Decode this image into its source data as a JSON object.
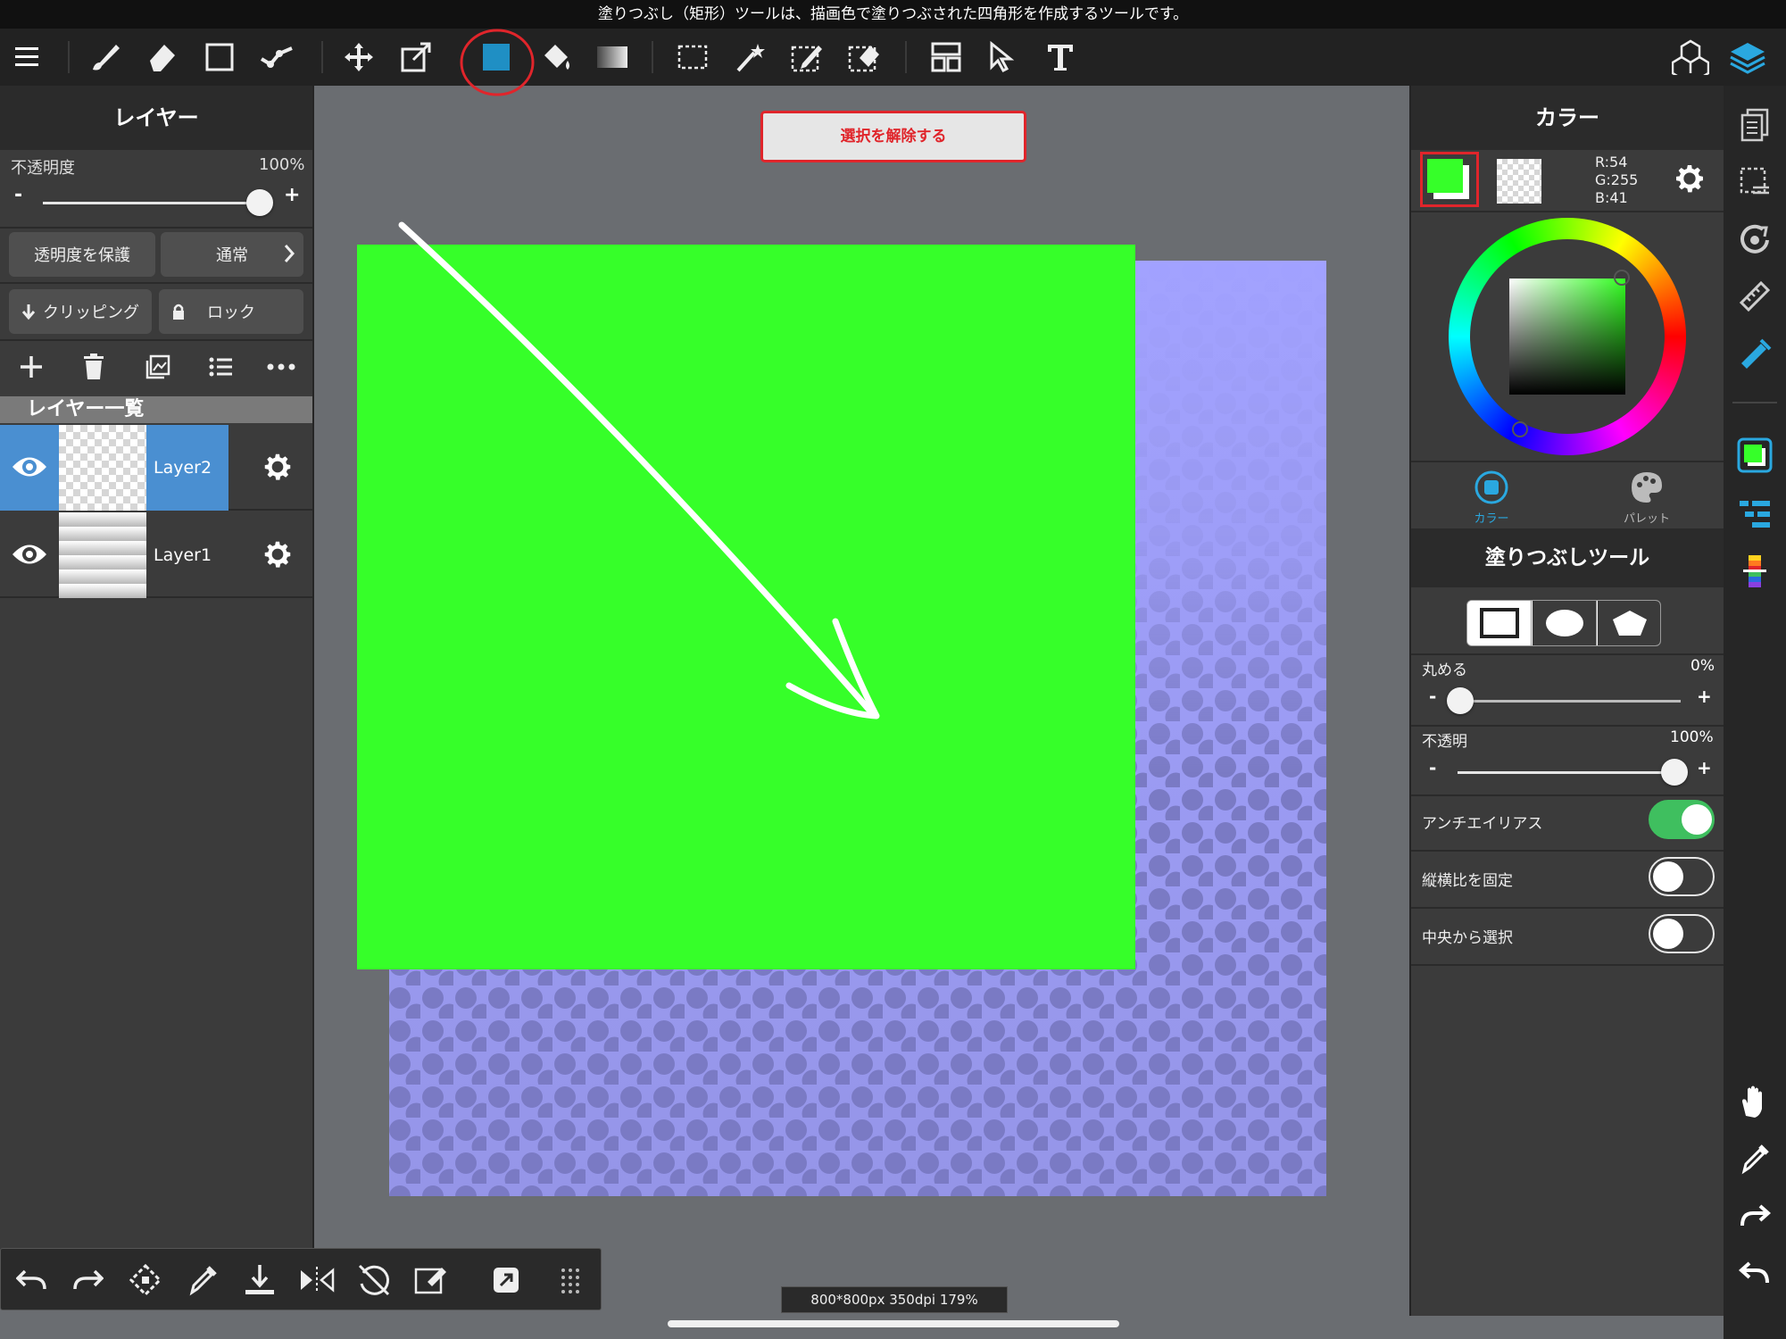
{
  "caption": "塗りつぶし（矩形）ツールは、描画色で塗りつぶされた四角形を作成するツールです。",
  "toolbar": {
    "tools": [
      "menu-icon",
      "brush-icon",
      "eraser-icon",
      "shape-icon",
      "snap-icon",
      "move-icon",
      "transform-icon",
      "fill-rect-icon",
      "bucket-icon",
      "gradient-icon",
      "select-rect-icon",
      "magic-wand-icon",
      "select-pen-icon",
      "select-eraser-icon",
      "frame-divider-icon",
      "operation-icon",
      "text-icon",
      "3d-material-icon",
      "layers-icon"
    ],
    "active_tool_color": "#1f8fc4",
    "highlight_color": "#e0252b"
  },
  "left": {
    "title": "レイヤー",
    "opacity_label": "不透明度",
    "opacity_value": "100%",
    "opacity": 1.0,
    "minus": "-",
    "plus": "+",
    "protect_alpha": "透明度を保護",
    "blend_mode": "通常",
    "clipping": "クリッピング",
    "lock": "ロック",
    "list_title": "レイヤー一覧",
    "layers": [
      {
        "name": "Layer2",
        "selected": true
      },
      {
        "name": "Layer1",
        "selected": false
      }
    ]
  },
  "canvas": {
    "deselect": "選択を解除する",
    "info": "800*800px 350dpi 179%"
  },
  "color": {
    "title": "カラー",
    "r": "R:54",
    "g": "G:255",
    "b": "B:41",
    "foreground": "#36ff29",
    "tab_color": "カラー",
    "tab_palette": "パレット"
  },
  "fill_tool": {
    "title": "塗りつぶしツール",
    "round_label": "丸める",
    "round_value": "0%",
    "round": 0.0,
    "opacity_label": "不透明",
    "opacity_value": "100%",
    "opacity": 1.0,
    "minus": "-",
    "plus": "+",
    "antialias": "アンチエイリアス",
    "antialias_on": true,
    "fix_ratio": "縦横比を固定",
    "fix_ratio_on": false,
    "from_center": "中央から選択",
    "from_center_on": false,
    "toggle_on_color": "#3fbf5f"
  }
}
